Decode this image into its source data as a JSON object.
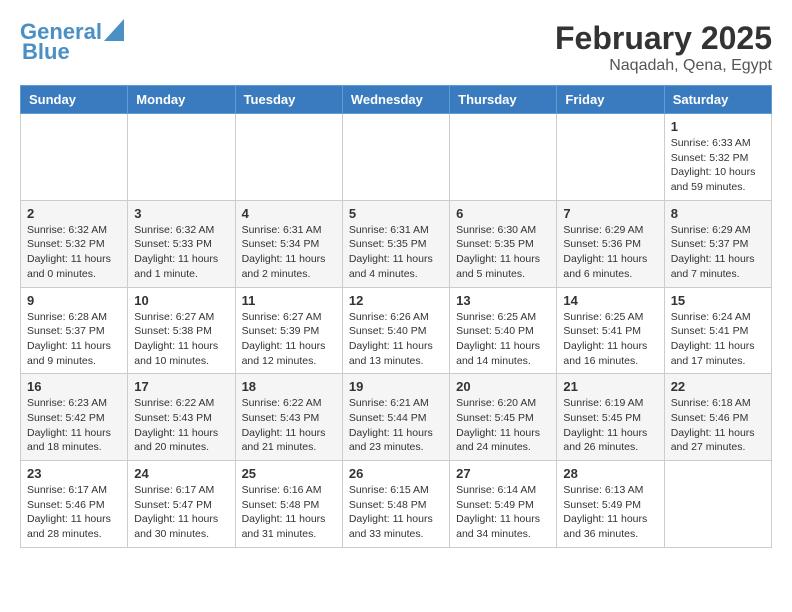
{
  "header": {
    "logo_line1": "General",
    "logo_line2": "Blue",
    "month": "February 2025",
    "location": "Naqadah, Qena, Egypt"
  },
  "weekdays": [
    "Sunday",
    "Monday",
    "Tuesday",
    "Wednesday",
    "Thursday",
    "Friday",
    "Saturday"
  ],
  "weeks": [
    [
      {
        "day": "",
        "info": ""
      },
      {
        "day": "",
        "info": ""
      },
      {
        "day": "",
        "info": ""
      },
      {
        "day": "",
        "info": ""
      },
      {
        "day": "",
        "info": ""
      },
      {
        "day": "",
        "info": ""
      },
      {
        "day": "1",
        "info": "Sunrise: 6:33 AM\nSunset: 5:32 PM\nDaylight: 10 hours and 59 minutes."
      }
    ],
    [
      {
        "day": "2",
        "info": "Sunrise: 6:32 AM\nSunset: 5:32 PM\nDaylight: 11 hours and 0 minutes."
      },
      {
        "day": "3",
        "info": "Sunrise: 6:32 AM\nSunset: 5:33 PM\nDaylight: 11 hours and 1 minute."
      },
      {
        "day": "4",
        "info": "Sunrise: 6:31 AM\nSunset: 5:34 PM\nDaylight: 11 hours and 2 minutes."
      },
      {
        "day": "5",
        "info": "Sunrise: 6:31 AM\nSunset: 5:35 PM\nDaylight: 11 hours and 4 minutes."
      },
      {
        "day": "6",
        "info": "Sunrise: 6:30 AM\nSunset: 5:35 PM\nDaylight: 11 hours and 5 minutes."
      },
      {
        "day": "7",
        "info": "Sunrise: 6:29 AM\nSunset: 5:36 PM\nDaylight: 11 hours and 6 minutes."
      },
      {
        "day": "8",
        "info": "Sunrise: 6:29 AM\nSunset: 5:37 PM\nDaylight: 11 hours and 7 minutes."
      }
    ],
    [
      {
        "day": "9",
        "info": "Sunrise: 6:28 AM\nSunset: 5:37 PM\nDaylight: 11 hours and 9 minutes."
      },
      {
        "day": "10",
        "info": "Sunrise: 6:27 AM\nSunset: 5:38 PM\nDaylight: 11 hours and 10 minutes."
      },
      {
        "day": "11",
        "info": "Sunrise: 6:27 AM\nSunset: 5:39 PM\nDaylight: 11 hours and 12 minutes."
      },
      {
        "day": "12",
        "info": "Sunrise: 6:26 AM\nSunset: 5:40 PM\nDaylight: 11 hours and 13 minutes."
      },
      {
        "day": "13",
        "info": "Sunrise: 6:25 AM\nSunset: 5:40 PM\nDaylight: 11 hours and 14 minutes."
      },
      {
        "day": "14",
        "info": "Sunrise: 6:25 AM\nSunset: 5:41 PM\nDaylight: 11 hours and 16 minutes."
      },
      {
        "day": "15",
        "info": "Sunrise: 6:24 AM\nSunset: 5:41 PM\nDaylight: 11 hours and 17 minutes."
      }
    ],
    [
      {
        "day": "16",
        "info": "Sunrise: 6:23 AM\nSunset: 5:42 PM\nDaylight: 11 hours and 18 minutes."
      },
      {
        "day": "17",
        "info": "Sunrise: 6:22 AM\nSunset: 5:43 PM\nDaylight: 11 hours and 20 minutes."
      },
      {
        "day": "18",
        "info": "Sunrise: 6:22 AM\nSunset: 5:43 PM\nDaylight: 11 hours and 21 minutes."
      },
      {
        "day": "19",
        "info": "Sunrise: 6:21 AM\nSunset: 5:44 PM\nDaylight: 11 hours and 23 minutes."
      },
      {
        "day": "20",
        "info": "Sunrise: 6:20 AM\nSunset: 5:45 PM\nDaylight: 11 hours and 24 minutes."
      },
      {
        "day": "21",
        "info": "Sunrise: 6:19 AM\nSunset: 5:45 PM\nDaylight: 11 hours and 26 minutes."
      },
      {
        "day": "22",
        "info": "Sunrise: 6:18 AM\nSunset: 5:46 PM\nDaylight: 11 hours and 27 minutes."
      }
    ],
    [
      {
        "day": "23",
        "info": "Sunrise: 6:17 AM\nSunset: 5:46 PM\nDaylight: 11 hours and 28 minutes."
      },
      {
        "day": "24",
        "info": "Sunrise: 6:17 AM\nSunset: 5:47 PM\nDaylight: 11 hours and 30 minutes."
      },
      {
        "day": "25",
        "info": "Sunrise: 6:16 AM\nSunset: 5:48 PM\nDaylight: 11 hours and 31 minutes."
      },
      {
        "day": "26",
        "info": "Sunrise: 6:15 AM\nSunset: 5:48 PM\nDaylight: 11 hours and 33 minutes."
      },
      {
        "day": "27",
        "info": "Sunrise: 6:14 AM\nSunset: 5:49 PM\nDaylight: 11 hours and 34 minutes."
      },
      {
        "day": "28",
        "info": "Sunrise: 6:13 AM\nSunset: 5:49 PM\nDaylight: 11 hours and 36 minutes."
      },
      {
        "day": "",
        "info": ""
      }
    ]
  ]
}
